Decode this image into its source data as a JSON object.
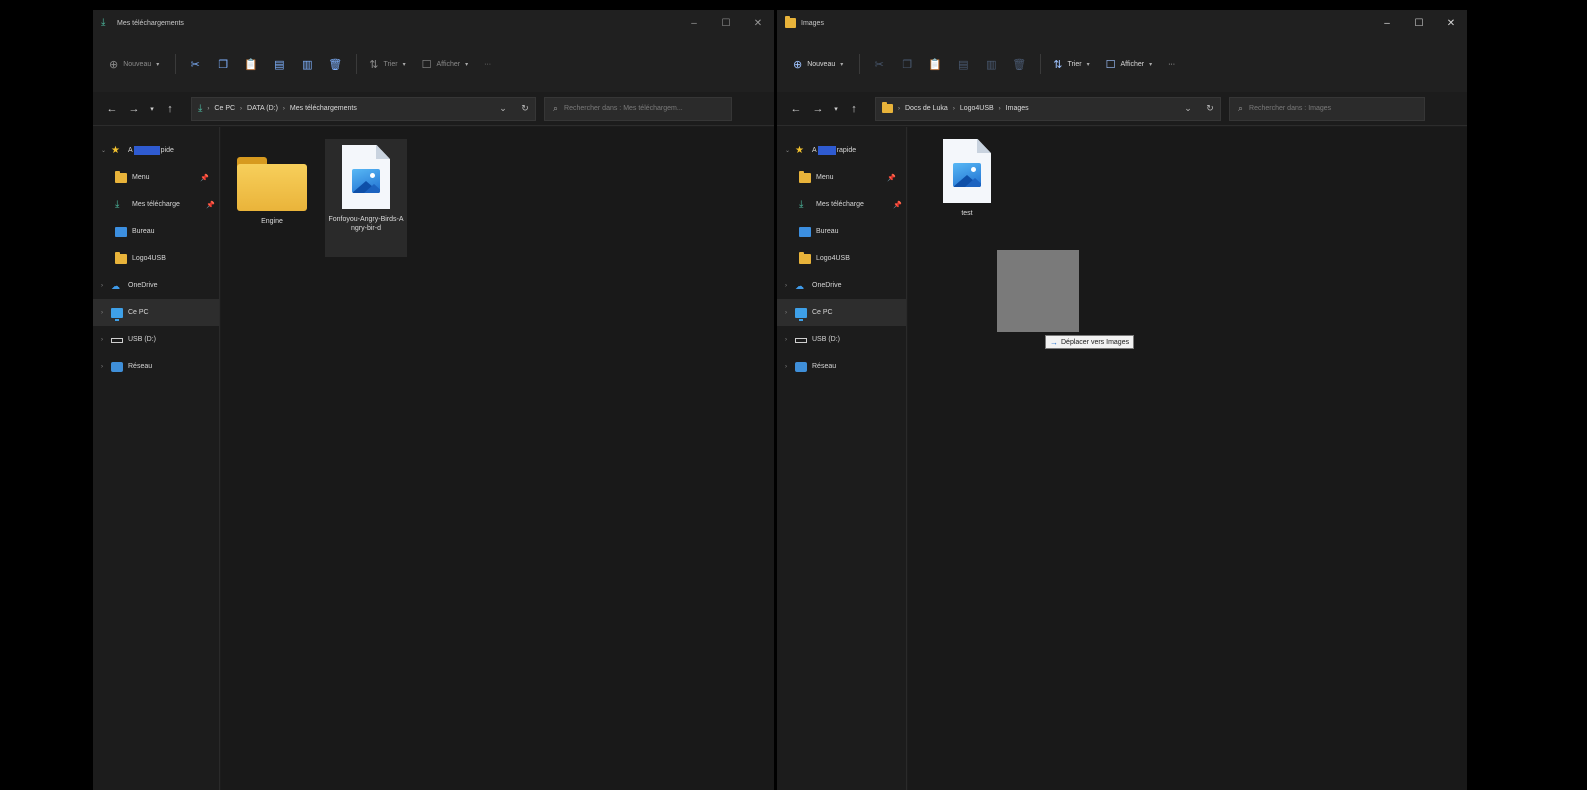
{
  "left_window": {
    "title": "Mes téléchargements",
    "toolbar": {
      "new_label": "Nouveau",
      "sort_label": "Trier",
      "view_label": "Afficher",
      "more_label": "···"
    },
    "breadcrumbs": [
      "Ce PC",
      "DATA (D:)",
      "Mes téléchargements"
    ],
    "search_placeholder": "Rechercher dans : Mes téléchargem...",
    "nav": {
      "quick_access_prefix": "A",
      "quick_access_suffix": "pide",
      "items": [
        {
          "label": "Menu",
          "icon": "folder-icon"
        },
        {
          "label": "Mes télécharge",
          "icon": "download-icon"
        },
        {
          "label": "Bureau",
          "icon": "desktop-icon"
        },
        {
          "label": "Logo4USB",
          "icon": "folder-icon"
        }
      ],
      "onedrive": "OneDrive",
      "this_pc": "Ce PC",
      "usb": "USB (D:)",
      "network": "Réseau"
    },
    "files": [
      {
        "name": "Engine",
        "type": "folder"
      },
      {
        "name": "Fonfoyou-Angry-Birds-Angry-bir-d",
        "type": "image"
      }
    ]
  },
  "right_window": {
    "title": "Images",
    "toolbar": {
      "new_label": "Nouveau",
      "sort_label": "Trier",
      "view_label": "Afficher",
      "more_label": "···"
    },
    "breadcrumbs": [
      "Docs de Luka",
      "Logo4USB",
      "Images"
    ],
    "search_placeholder": "Rechercher dans : Images",
    "nav": {
      "quick_access_prefix": "A",
      "quick_access_suffix": "rapide",
      "items": [
        {
          "label": "Menu",
          "icon": "folder-icon"
        },
        {
          "label": "Mes télécharge",
          "icon": "download-icon"
        },
        {
          "label": "Bureau",
          "icon": "desktop-icon"
        },
        {
          "label": "Logo4USB",
          "icon": "folder-icon"
        }
      ],
      "onedrive": "OneDrive",
      "this_pc": "Ce PC",
      "usb": "USB (D:)",
      "network": "Réseau"
    },
    "files": [
      {
        "name": "test",
        "type": "image"
      }
    ]
  },
  "drag": {
    "tooltip": "Déplacer vers Images"
  },
  "colors": {
    "folder": "#e8b33a",
    "accent": "#1f6fd0",
    "redaction": "#2f5bd1",
    "window_bg": "#1c1c1c"
  }
}
